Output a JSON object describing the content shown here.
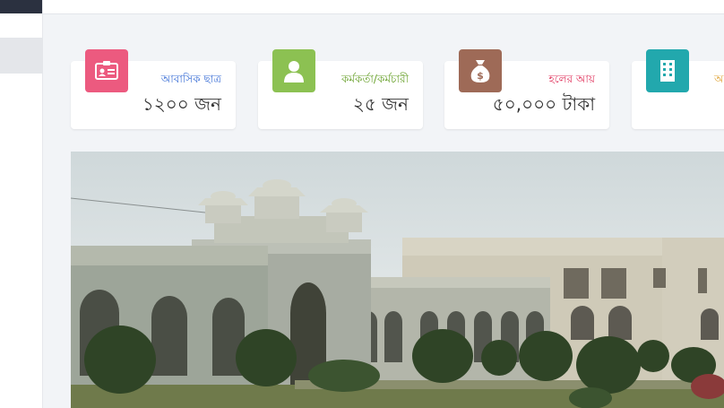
{
  "cards": [
    {
      "label": "আবাসিক ছাত্র",
      "value": "১২০০ জন",
      "icon": "id-card-icon"
    },
    {
      "label": "কর্মকর্তা/কর্মচারী",
      "value": "২৫ জন",
      "icon": "user-icon"
    },
    {
      "label": "হলের আয়",
      "value": "৫০,০০০ টাকা",
      "icon": "money-bag-icon"
    },
    {
      "label": "অ",
      "value": "",
      "icon": "building-icon"
    }
  ],
  "colors": {
    "card1_icon": "#ec5a7f",
    "card2_icon": "#8cc152",
    "card3_icon": "#9e6a57",
    "card4_icon": "#22a8ad"
  },
  "banner": {
    "subject": "hall-building-photo"
  }
}
